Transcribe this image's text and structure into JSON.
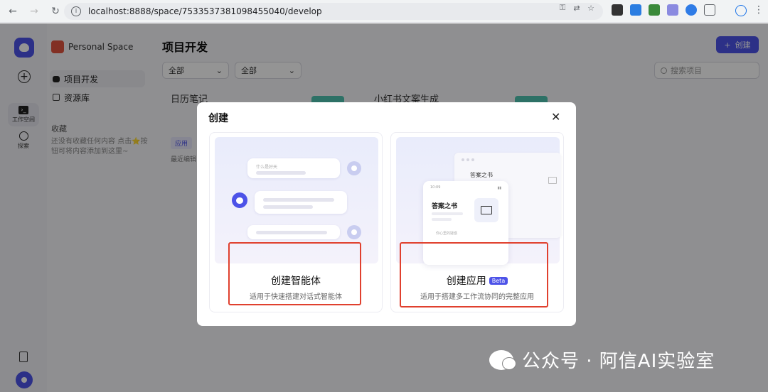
{
  "browser": {
    "url": "localhost:8888/space/7533537381098455040/develop"
  },
  "rail": {
    "workspace_label": "工作空间",
    "explore_label": "探索"
  },
  "sidebar": {
    "space_name": "Personal Space",
    "items": [
      {
        "label": "项目开发"
      },
      {
        "label": "资源库"
      }
    ],
    "favorites_title": "收藏",
    "favorites_empty": "还没有收藏任何内容 点击⭐按钮可将内容添加到这里~"
  },
  "main": {
    "title": "项目开发",
    "create_label": "创建",
    "filter1": "全部",
    "filter2": "全部",
    "search_placeholder": "搜索项目",
    "card1_title": "日历笔记",
    "card2_title": "小红书文案生成",
    "card_tag": "应用",
    "card_sub": "最近编辑"
  },
  "modal": {
    "title": "创建",
    "options": [
      {
        "title": "创建智能体",
        "desc": "适用于快速搭建对话式智能体",
        "preview_prompt": "什么是好天"
      },
      {
        "title": "创建应用",
        "badge": "Beta",
        "desc": "适用于搭建多工作流协同的完整应用",
        "preview_title": "答案之书",
        "preview_time": "10:09",
        "preview_foot": "你心里的疑惑"
      }
    ]
  },
  "watermark": {
    "text": "公众号 · 阿信AI实验室"
  },
  "colors": {
    "brand": "#4d53e8",
    "highlight": "#e0402e"
  }
}
